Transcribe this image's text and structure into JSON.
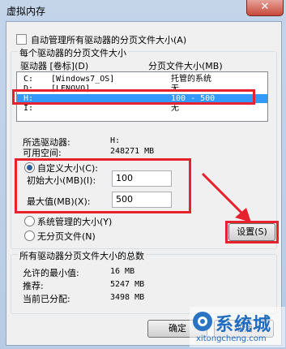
{
  "window": {
    "title": "虚拟内存",
    "close_glyph": "✕"
  },
  "auto_manage": {
    "label": "自动管理所有驱动器的分页文件大小(A)",
    "checked": false
  },
  "group_drives": {
    "title": "每个驱动器的分页文件大小",
    "col_drive": "驱动器 [卷标](D)",
    "col_size": "分页文件大小(MB)",
    "rows": [
      {
        "drive": "C:",
        "label": "[Windows7_OS]",
        "size": "托管的系统"
      },
      {
        "drive": "D:",
        "label": "[LENOVO]",
        "size": "无"
      },
      {
        "drive": "H:",
        "label": "",
        "size": "100 - 500"
      },
      {
        "drive": "I:",
        "label": "",
        "size": "无"
      }
    ],
    "selected_drive_label": "所选驱动器:",
    "selected_drive_value": "H:",
    "free_space_label": "可用空间:",
    "free_space_value": "248271 MB",
    "custom_label": "自定义大小(C):",
    "initial_label": "初始大小(MB)(I):",
    "initial_value": "100",
    "max_label": "最大值(MB)(X):",
    "max_value": "500",
    "system_managed_label": "系统管理的大小(Y)",
    "no_paging_label": "无分页文件(N)",
    "set_button": "设置(S)"
  },
  "group_total": {
    "title": "所有驱动器分页文件大小的总数",
    "min_label": "允许的最小值:",
    "min_value": "16 MB",
    "recommended_label": "推荐:",
    "recommended_value": "5247 MB",
    "current_label": "当前已分配:",
    "current_value": "3498 MB"
  },
  "footer": {
    "ok_button": "确定",
    "cancel_button": "取消"
  },
  "watermark": {
    "brand": "系统城",
    "url": "xitongcheng.com"
  },
  "colors": {
    "annotation_red": "#e8212e",
    "selection_blue": "#3399ff"
  }
}
